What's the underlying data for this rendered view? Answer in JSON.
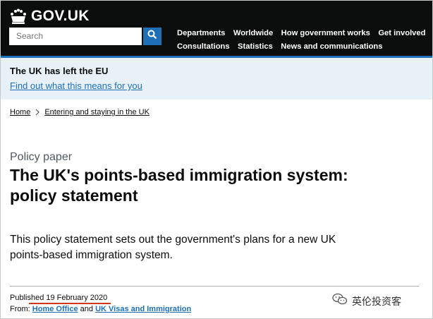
{
  "header": {
    "logo_text": "GOV.UK",
    "search_placeholder": "Search",
    "nav": [
      "Departments",
      "Worldwide",
      "How government works",
      "Get involved",
      "Consultations",
      "Statistics",
      "News and communications"
    ]
  },
  "banner": {
    "title": "The UK has left the EU",
    "link": "Find out what this means for you"
  },
  "breadcrumb": [
    "Home",
    "Entering and staying in the UK"
  ],
  "document": {
    "type": "Policy paper",
    "title": "The UK's points-based immigration system: policy statement",
    "summary": "This policy statement sets out the government's plans for a new UK points-based immigration system.",
    "published_label": "Published",
    "published_date": "19 February 2020",
    "from_label": "From:",
    "from_orgs": [
      "Home Office",
      "UK Visas and Immigration"
    ],
    "from_joiner": "and"
  },
  "watermark": "英伦投资客",
  "colors": {
    "header_bg": "#0b0c0c",
    "link_blue": "#1d70b8",
    "banner_bg": "#e8f1f8",
    "annotation_red": "#d4351c"
  }
}
